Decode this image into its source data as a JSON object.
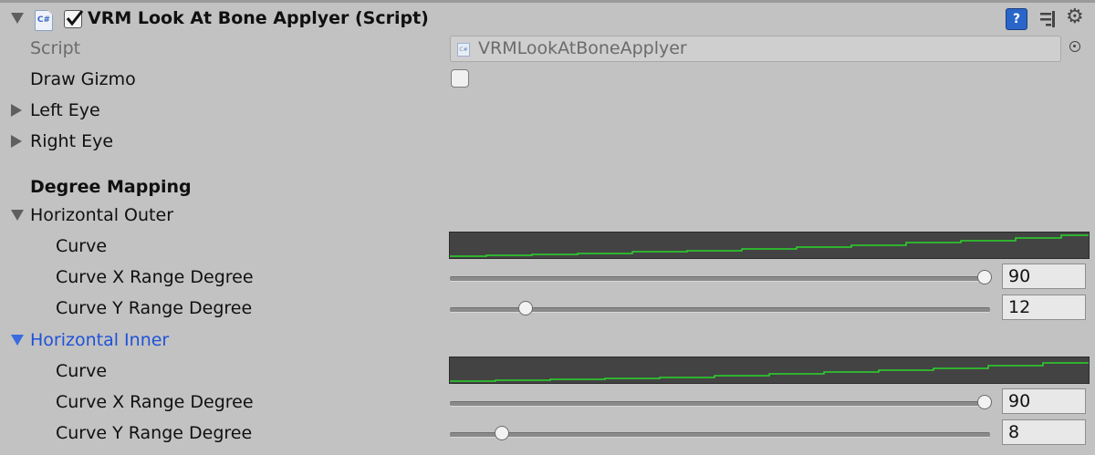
{
  "header": {
    "title": "VRM Look At Bone Applyer (Script)",
    "enabled": true,
    "script_icon": "C#",
    "icons": [
      "help-icon",
      "preset-icon",
      "gear-icon"
    ]
  },
  "fields": {
    "script": {
      "label": "Script",
      "value": "VRMLookAtBoneApplyer",
      "mini_icon": "C#"
    },
    "draw_gizmo": {
      "label": "Draw Gizmo",
      "checked": false
    },
    "left_eye": {
      "label": "Left Eye",
      "expanded": false
    },
    "right_eye": {
      "label": "Right Eye",
      "expanded": false
    }
  },
  "degree_mapping": {
    "section_label": "Degree Mapping",
    "horizontal_outer": {
      "label": "Horizontal Outer",
      "expanded": true,
      "curve_label": "Curve",
      "x_range_label": "Curve X Range Degree",
      "x_range_value": "90",
      "y_range_label": "Curve Y Range Degree",
      "y_range_value": "12"
    },
    "horizontal_inner": {
      "label": "Horizontal Inner",
      "expanded": true,
      "curve_label": "Curve",
      "x_range_label": "Curve X Range Degree",
      "x_range_value": "90",
      "y_range_label": "Curve Y Range Degree",
      "y_range_value": "8"
    }
  },
  "colors": {
    "background": "#c2c2c2",
    "curve_bg": "#434343",
    "curve_line": "#2bd62b",
    "selected_foldout": "#1e52d8"
  }
}
